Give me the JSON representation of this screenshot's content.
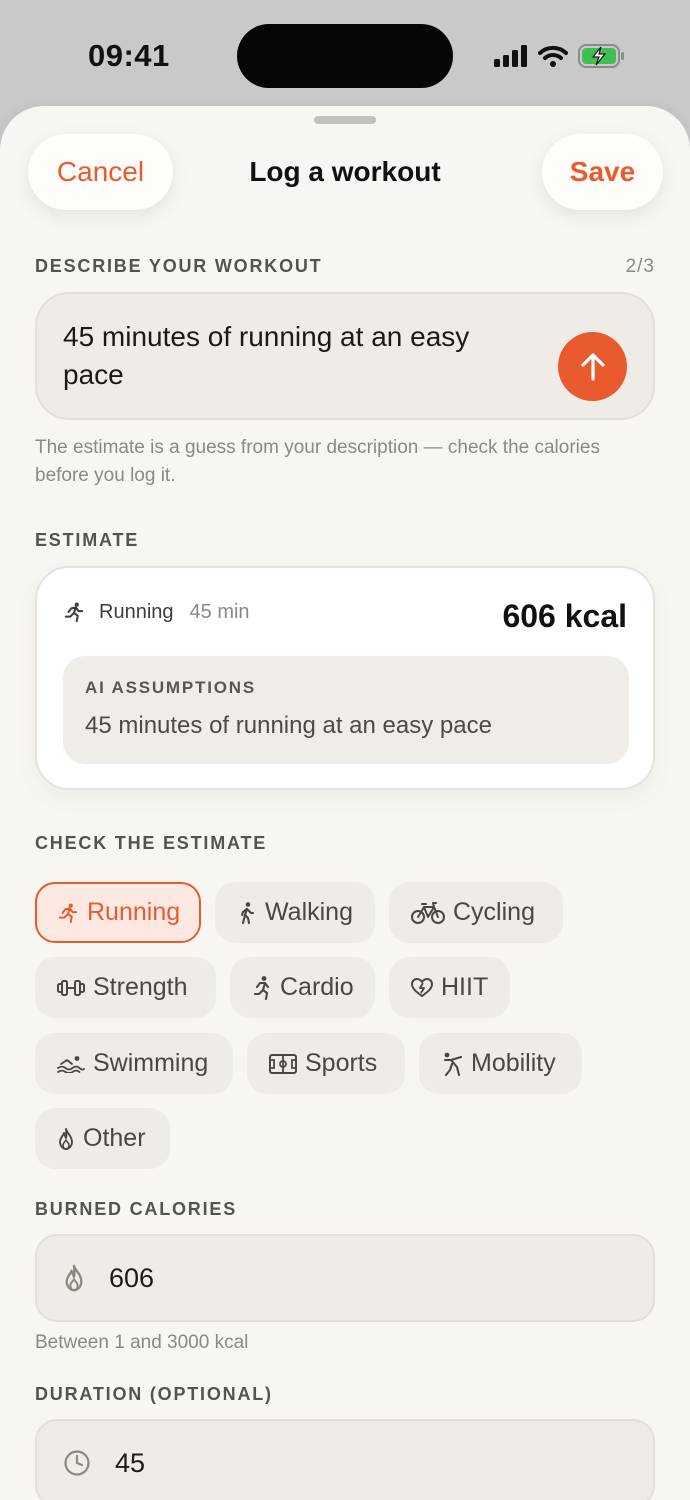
{
  "status_bar": {
    "time": "09:41"
  },
  "header": {
    "cancel_label": "Cancel",
    "title": "Log a workout",
    "save_label": "Save"
  },
  "describe": {
    "label": "DESCRIBE YOUR WORKOUT",
    "counter": "2/3",
    "text": "45 minutes of running at an easy pace",
    "help": "The estimate is a guess from your description — check the calories before you log it."
  },
  "estimate": {
    "label": "ESTIMATE",
    "activity": "Running",
    "duration": "45 min",
    "kcal": "606 kcal",
    "assumptions_label": "AI ASSUMPTIONS",
    "assumptions_text": "45 minutes of running at an easy pace"
  },
  "check": {
    "label": "CHECK THE ESTIMATE",
    "chips": [
      {
        "label": "Running",
        "icon": "running-icon",
        "selected": true
      },
      {
        "label": "Walking",
        "icon": "walking-icon",
        "selected": false
      },
      {
        "label": "Cycling",
        "icon": "bicycle-icon",
        "selected": false
      },
      {
        "label": "Strength",
        "icon": "dumbbell-icon",
        "selected": false
      },
      {
        "label": "Cardio",
        "icon": "cardio-icon",
        "selected": false
      },
      {
        "label": "HIIT",
        "icon": "heart-bolt-icon",
        "selected": false
      },
      {
        "label": "Swimming",
        "icon": "swimming-icon",
        "selected": false
      },
      {
        "label": "Sports",
        "icon": "field-icon",
        "selected": false
      },
      {
        "label": "Mobility",
        "icon": "stretch-icon",
        "selected": false
      },
      {
        "label": "Other",
        "icon": "flame-icon",
        "selected": false
      }
    ]
  },
  "calories": {
    "label": "BURNED CALORIES",
    "value": "606",
    "hint": "Between 1 and 3000 kcal"
  },
  "duration": {
    "label": "DURATION (OPTIONAL)",
    "value": "45"
  },
  "colors": {
    "accent": "#ea5a2f",
    "background": "#f8f6f3",
    "chip": "#efece8"
  }
}
